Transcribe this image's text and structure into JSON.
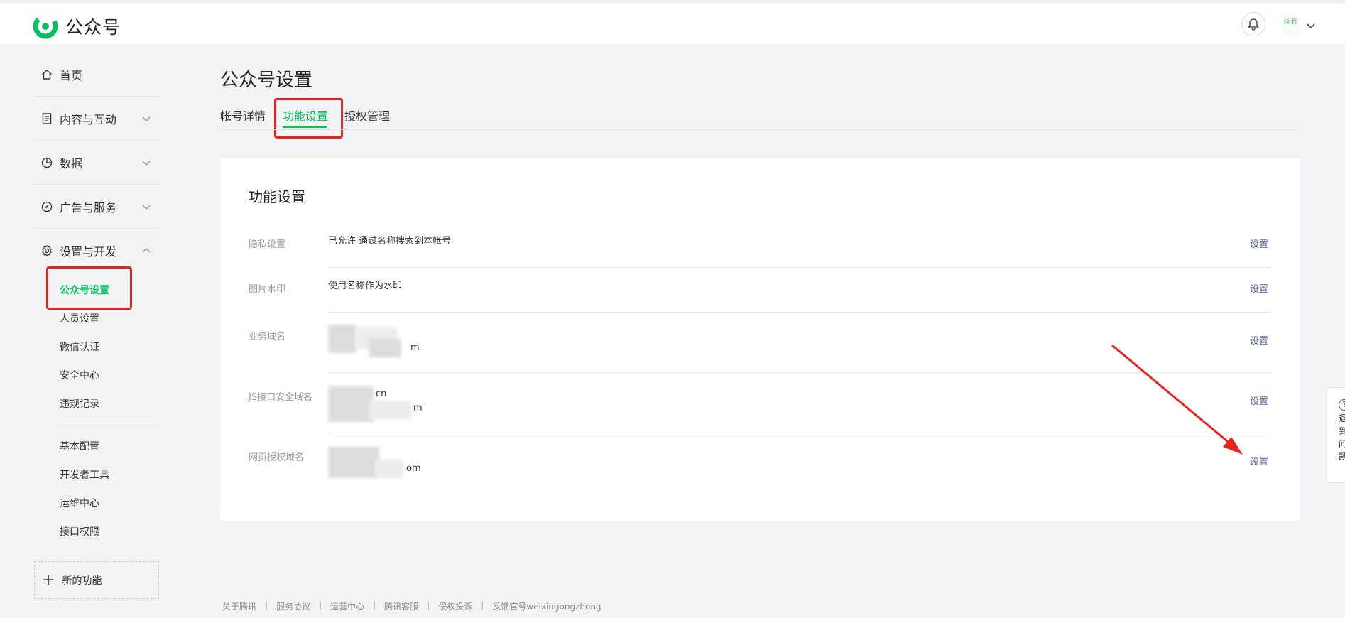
{
  "app": {
    "name": "公众号",
    "brand_color": "#07c160",
    "avatar_text": "抖 我"
  },
  "sidebar": {
    "items": [
      {
        "label": "首页",
        "icon": "home-icon"
      },
      {
        "label": "内容与互动",
        "icon": "document-icon"
      },
      {
        "label": "数据",
        "icon": "pie-chart-icon"
      },
      {
        "label": "广告与服务",
        "icon": "compass-icon"
      },
      {
        "label": "设置与开发",
        "icon": "gear-icon"
      }
    ],
    "sub_items": [
      "公众号设置",
      "人员设置",
      "微信认证",
      "安全中心",
      "违规记录"
    ],
    "sub_items_2": [
      "基本配置",
      "开发者工具",
      "运维中心",
      "接口权限"
    ],
    "new_feature": "新的功能"
  },
  "main": {
    "title": "公众号设置",
    "tabs": [
      "帐号详情",
      "功能设置",
      "授权管理"
    ],
    "active_tab": "功能设置",
    "card_title": "功能设置",
    "rows": [
      {
        "label": "隐私设置",
        "value": "已允许 通过名称搜索到本帐号",
        "action": "设置"
      },
      {
        "label": "图片水印",
        "value": "使用名称作为水印",
        "action": "设置"
      },
      {
        "label": "业务域名",
        "value_line1": "",
        "value_line2": "m",
        "action": "设置"
      },
      {
        "label": "JS接口安全域名",
        "value_line1": "cn",
        "value_line2": "m",
        "action": "设置"
      },
      {
        "label": "网页授权域名",
        "value_line1": "",
        "value_line2": "om",
        "action": "设置"
      }
    ]
  },
  "help": {
    "icon": "question-icon",
    "chars": [
      "遇",
      "到",
      "问",
      "题"
    ]
  },
  "footer": {
    "links": [
      "关于腾讯",
      "服务协议",
      "运营中心",
      "腾讯客服",
      "侵权投诉",
      "反馈官号weixingongzhong"
    ]
  },
  "colors": {
    "highlight": "#e8231d",
    "link": "#576b95",
    "annotation_arrow": "#e8231d"
  }
}
